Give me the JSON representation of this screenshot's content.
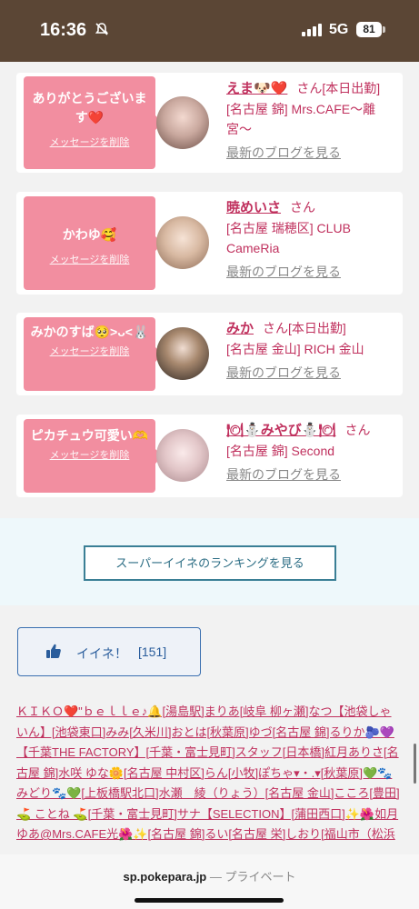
{
  "status_bar": {
    "time": "16:36",
    "network": "5G",
    "battery": "81"
  },
  "cards": [
    {
      "message": "ありがとうございます❤️",
      "delete_label": "メッセージを削除",
      "name": "えま🐶❤️",
      "suffix": "さん[本日出勤]",
      "shop": "[名古屋 錦] Mrs.CAFE〜離宮〜",
      "blog_label": "最新のブログを見る"
    },
    {
      "message": "かわゆ🥰",
      "delete_label": "メッセージを削除",
      "name": "暁めいさ",
      "suffix": "さん",
      "shop": "[名古屋 瑞穂区] CLUB CameRia",
      "blog_label": "最新のブログを見る"
    },
    {
      "message": "みかのすば🥺>︎ᴗ<🐰",
      "delete_label": "メッセージを削除",
      "name": "みか",
      "suffix": "さん[本日出勤]",
      "shop": "[名古屋 金山] RICH 金山",
      "blog_label": "最新のブログを見る"
    },
    {
      "message": "ピカチュウ可愛い🫶",
      "delete_label": "メッセージを削除",
      "name": "🍽⛄みやび⛄🍽",
      "suffix": "さん",
      "shop": "[名古屋 錦] Second",
      "blog_label": "最新のブログを見る"
    }
  ],
  "ranking": {
    "button_label": "スーパーイイネのランキングを見る"
  },
  "iine": {
    "label": "イイネ！",
    "count": "[151]",
    "icon": "thumbs-up-icon"
  },
  "liked_by_text": "ＫＩＫＯ❤️\"ｂｅｌｌｅ♪🔔[湯島駅]まりあ[岐阜 柳ヶ瀬]なつ【池袋しゃいん】[池袋東口]みみ[久米川]おとは[秋葉原]ゆづ[名古屋 錦]るりか🫐💜【千葉THE FACTORY】[千葉・富士見町]スタッフ[日本橋]紅月ありさ[名古屋 錦]水咲 ゆな🌼[名古屋 中村区]らん[小牧]ぽちゃ▾・.▾[秋葉原]💚🐾みどり🐾💚[上板橋駅北口]水瀬　綾（りょう）[名古屋 金山]こころ[豊田]⛳ ことね ⛳[千葉・富士見町]サナ【SELECTION】[蒲田西口]✨🌺如月ゆあ@Mrs.CAFE光🌺✨[名古屋 錦]るい[名古屋 栄]しおり[福山市（松浜町）]るな[名古屋 錦]ま",
  "url_bar": {
    "host": "sp.pokepara.jp",
    "separator": " — ",
    "mode": "プライベート"
  },
  "colors": {
    "status_bar": "#5b4635",
    "bubble": "#f28ea0",
    "name_text": "#c0315e",
    "ranking_border": "#3a7f95",
    "iine_border": "#3a6fb0"
  }
}
